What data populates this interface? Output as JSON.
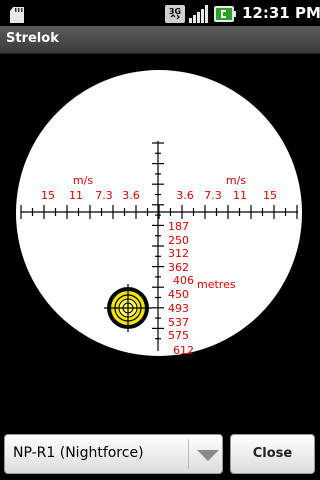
{
  "status_bar": {
    "time": "12:31 PM",
    "network_label": "3G",
    "icons": [
      "sd-card-icon",
      "3g-icon",
      "signal-icon",
      "battery-icon"
    ]
  },
  "app": {
    "title": "Strelok"
  },
  "reticle": {
    "wind_unit": "m/s",
    "wind_left_labels": [
      "15",
      "11",
      "7.3",
      "3.6"
    ],
    "wind_right_labels": [
      "3.6",
      "7.3",
      "11",
      "15"
    ],
    "distance_unit": "metres",
    "distance_labels": [
      "187",
      "250",
      "312",
      "362",
      "406",
      "450",
      "493",
      "537",
      "575",
      "612"
    ],
    "colors": {
      "label": "#e00000",
      "reticle_line": "#000000",
      "target_fill": "#f2e600"
    }
  },
  "controls": {
    "scope_select": "NP-R1 (Nightforce)",
    "close_label": "Close"
  }
}
